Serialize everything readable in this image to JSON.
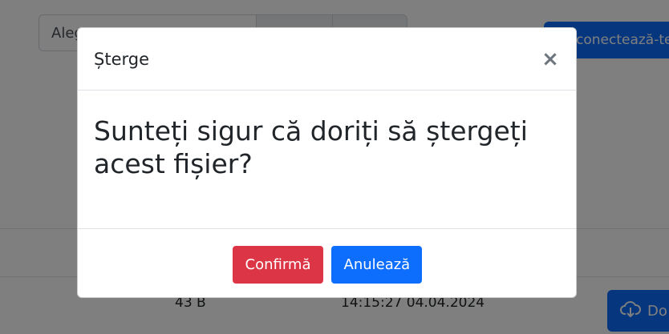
{
  "background": {
    "file_select_text": "Aleg",
    "connect_button_label": "conectează-te",
    "table_row": {
      "size": "43 B",
      "timestamp": "14:15:27 04.04.2024"
    },
    "download_button_label": "Do"
  },
  "modal": {
    "title": "Șterge",
    "close_symbol": "×",
    "question": "Sunteți sigur că doriți să ștergeți acest fișier?",
    "confirm_label": "Confirmă",
    "cancel_label": "Anulează"
  },
  "colors": {
    "danger": "#dc3545",
    "primary": "#0d6efd",
    "backdrop": "rgba(0,0,0,0.5)"
  }
}
